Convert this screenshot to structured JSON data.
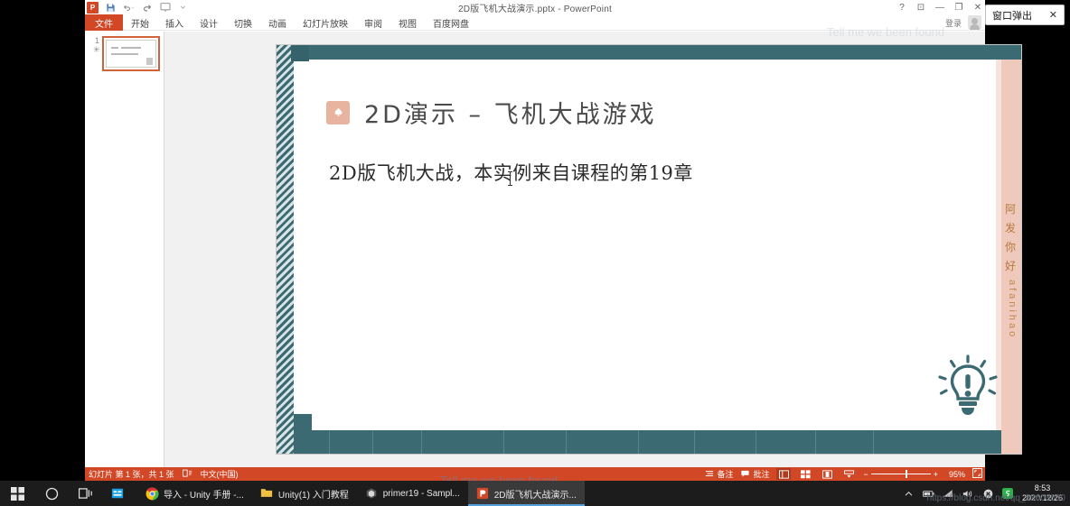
{
  "window": {
    "title": "2D版飞机大战演示.pptx - PowerPoint",
    "signin_label": "登录",
    "controls": {
      "help": "?",
      "ribbon_options": "⊡",
      "minimize": "—",
      "restore": "❐",
      "close": "✕"
    }
  },
  "quick_access": {
    "app_logo": "P",
    "save": "save-icon",
    "undo": "undo-icon",
    "redo": "redo-icon",
    "present": "present-icon",
    "customize": "chevron-down-icon"
  },
  "ribbon": {
    "tabs": [
      {
        "label": "文件",
        "active": true
      },
      {
        "label": "开始",
        "active": false
      },
      {
        "label": "插入",
        "active": false
      },
      {
        "label": "设计",
        "active": false
      },
      {
        "label": "切换",
        "active": false
      },
      {
        "label": "动画",
        "active": false
      },
      {
        "label": "幻灯片放映",
        "active": false
      },
      {
        "label": "审阅",
        "active": false
      },
      {
        "label": "视图",
        "active": false
      },
      {
        "label": "百度网盘",
        "active": false
      }
    ]
  },
  "thumbnail_pane": {
    "slides": [
      {
        "number": "1",
        "marker": "✳"
      }
    ]
  },
  "slide": {
    "title": "2D演示 – 飞机大战游戏",
    "body": "2D版飞机大战，本实例来自课程的第19章",
    "badge_icon": "spade-icon",
    "bulb_icon": "lightbulb-exclamation-icon",
    "watermark_cjk": [
      "阿",
      "发",
      "你",
      "好"
    ],
    "watermark_latin": "afanihao",
    "colors": {
      "deco_teal": "#3c6a72",
      "badge_salmon": "#e8b4a0",
      "right_pink": "#efc9bb"
    }
  },
  "statusbar": {
    "slide_count": "幻灯片 第 1 张，共 1 张",
    "language_icon": "language-icon",
    "language": "中文(中国)",
    "notes_label": "备注",
    "comments_label": "批注",
    "views": [
      {
        "name": "normal-view",
        "glyph": "▤",
        "active": true
      },
      {
        "name": "slide-sorter-view",
        "glyph": "▦",
        "active": false
      },
      {
        "name": "reading-view",
        "glyph": "▯",
        "active": false
      },
      {
        "name": "slideshow-view",
        "glyph": "▽",
        "active": false
      }
    ],
    "zoom_out": "−",
    "zoom_in": "+",
    "zoom_percent": "95%",
    "fit_window": "fit-to-window-icon"
  },
  "popup": {
    "label": "窗口弹出",
    "close": "✕"
  },
  "taskbar": {
    "system": [
      {
        "name": "start-button",
        "glyph": "⊞"
      },
      {
        "name": "cortana-search-button",
        "glyph": "◯"
      },
      {
        "name": "task-view-button",
        "glyph": "❐"
      }
    ],
    "apps": [
      {
        "label": "",
        "icon": "store-icon",
        "active": false,
        "color": "#0a84d8"
      },
      {
        "label": "导入 - Unity 手册 -...",
        "icon": "chrome-icon",
        "active": false,
        "color": "#4caf50"
      },
      {
        "label": "Unity(1) 入门教程",
        "icon": "folder-icon",
        "active": false,
        "color": "#f0c040"
      },
      {
        "label": "primer19 - Sampl...",
        "icon": "unity-icon",
        "active": false,
        "color": "#4a4a4a"
      },
      {
        "label": "2D版飞机大战演示...",
        "icon": "powerpoint-icon",
        "active": true,
        "color": "#d24726"
      }
    ],
    "tray": [
      {
        "name": "show-hidden-icons",
        "glyph": "⌃"
      },
      {
        "name": "battery-icon",
        "glyph": "▭"
      },
      {
        "name": "wifi-icon",
        "glyph": "◤"
      },
      {
        "name": "volume-icon",
        "glyph": "🔊"
      },
      {
        "name": "action-center-icon",
        "glyph": "✕"
      },
      {
        "name": "sogou-input-icon",
        "glyph": "S"
      }
    ],
    "clock_time": "8:53",
    "clock_date": "2020/12/26"
  },
  "overlays": {
    "url_watermark": "https://blog.csdn.net/qq_33608000",
    "center_watermark": "Tell me we been found",
    "top_watermark": "Tell me we been found"
  }
}
